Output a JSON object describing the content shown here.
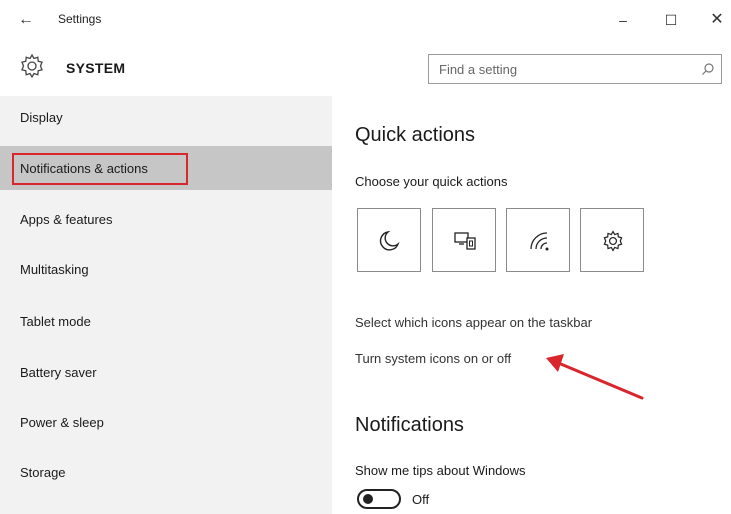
{
  "window": {
    "title": "Settings",
    "back_icon": "←",
    "minimize_icon": "–",
    "maximize_icon": "☐",
    "close_icon": "✕"
  },
  "header": {
    "title": "SYSTEM",
    "icon": "gear-icon"
  },
  "search": {
    "placeholder": "Find a setting",
    "icon": "search-icon"
  },
  "sidebar": {
    "items": [
      {
        "label": "Display",
        "selected": false
      },
      {
        "label": "Notifications & actions",
        "selected": true
      },
      {
        "label": "Apps & features",
        "selected": false
      },
      {
        "label": "Multitasking",
        "selected": false
      },
      {
        "label": "Tablet mode",
        "selected": false
      },
      {
        "label": "Battery saver",
        "selected": false
      },
      {
        "label": "Power & sleep",
        "selected": false
      },
      {
        "label": "Storage",
        "selected": false
      }
    ]
  },
  "main": {
    "quick_actions_heading": "Quick actions",
    "choose_label": "Choose your quick actions",
    "tiles": [
      {
        "icon": "moon-icon"
      },
      {
        "icon": "project-display-icon"
      },
      {
        "icon": "network-icon"
      },
      {
        "icon": "settings-gear-icon"
      }
    ],
    "taskbar_icons_link": "Select which icons appear on the taskbar",
    "system_icons_link": "Turn system icons on or off",
    "notifications_heading": "Notifications",
    "tips_label": "Show me tips about Windows",
    "tips_toggle_state": "Off"
  },
  "colors": {
    "sidebar_bg": "#f2f2f2",
    "selected_bg": "#c6c6c6",
    "highlight_red": "#d9262d"
  }
}
